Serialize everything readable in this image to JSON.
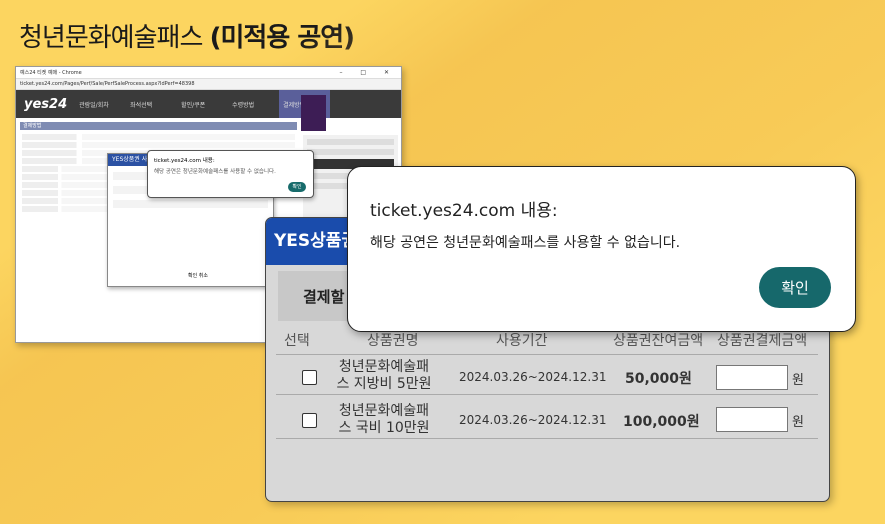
{
  "title_main": "청년문화예술패스 ",
  "title_bold": "(미적용 공연)",
  "browser": {
    "tab_title": "예스24 티켓 예매 - Chrome",
    "url": "ticket.yes24.com/Pages/Perf/Sale/PerfSaleProcess.aspx?IdPerf=48398",
    "logo": "yes24",
    "steps": [
      "관람일/회차",
      "좌석선택",
      "할인/쿠폰",
      "수령방법",
      "결제방법"
    ],
    "section_label": "결제방법",
    "mini_popup_title": "YES상품권 사",
    "mini_alert_title": "ticket.yes24.com 내용:",
    "mini_alert_msg": "해당 공연은 청년문화예술패스를 사용할 수 없습니다.",
    "mini_alert_btn": "확인",
    "mini_popup_btn_ok": "확인",
    "mini_popup_btn_cancel": "취소"
  },
  "popup": {
    "header": "YES상품권",
    "pay_label": "결제할",
    "columns": [
      "선택",
      "상품권명",
      "사용기간",
      "상품권잔여금액",
      "상품권결제금액"
    ],
    "rows": [
      {
        "name": "청년문화예술패스 지방비 5만원",
        "period": "2024.03.26~2024.12.31",
        "balance": "50,000원",
        "unit": "원"
      },
      {
        "name": "청년문화예술패스 국비 10만원",
        "period": "2024.03.26~2024.12.31",
        "balance": "100,000원",
        "unit": "원"
      }
    ]
  },
  "alert": {
    "title": "ticket.yes24.com 내용:",
    "message": "해당 공연은 청년문화예술패스를 사용할 수 없습니다.",
    "ok_button": "확인"
  }
}
